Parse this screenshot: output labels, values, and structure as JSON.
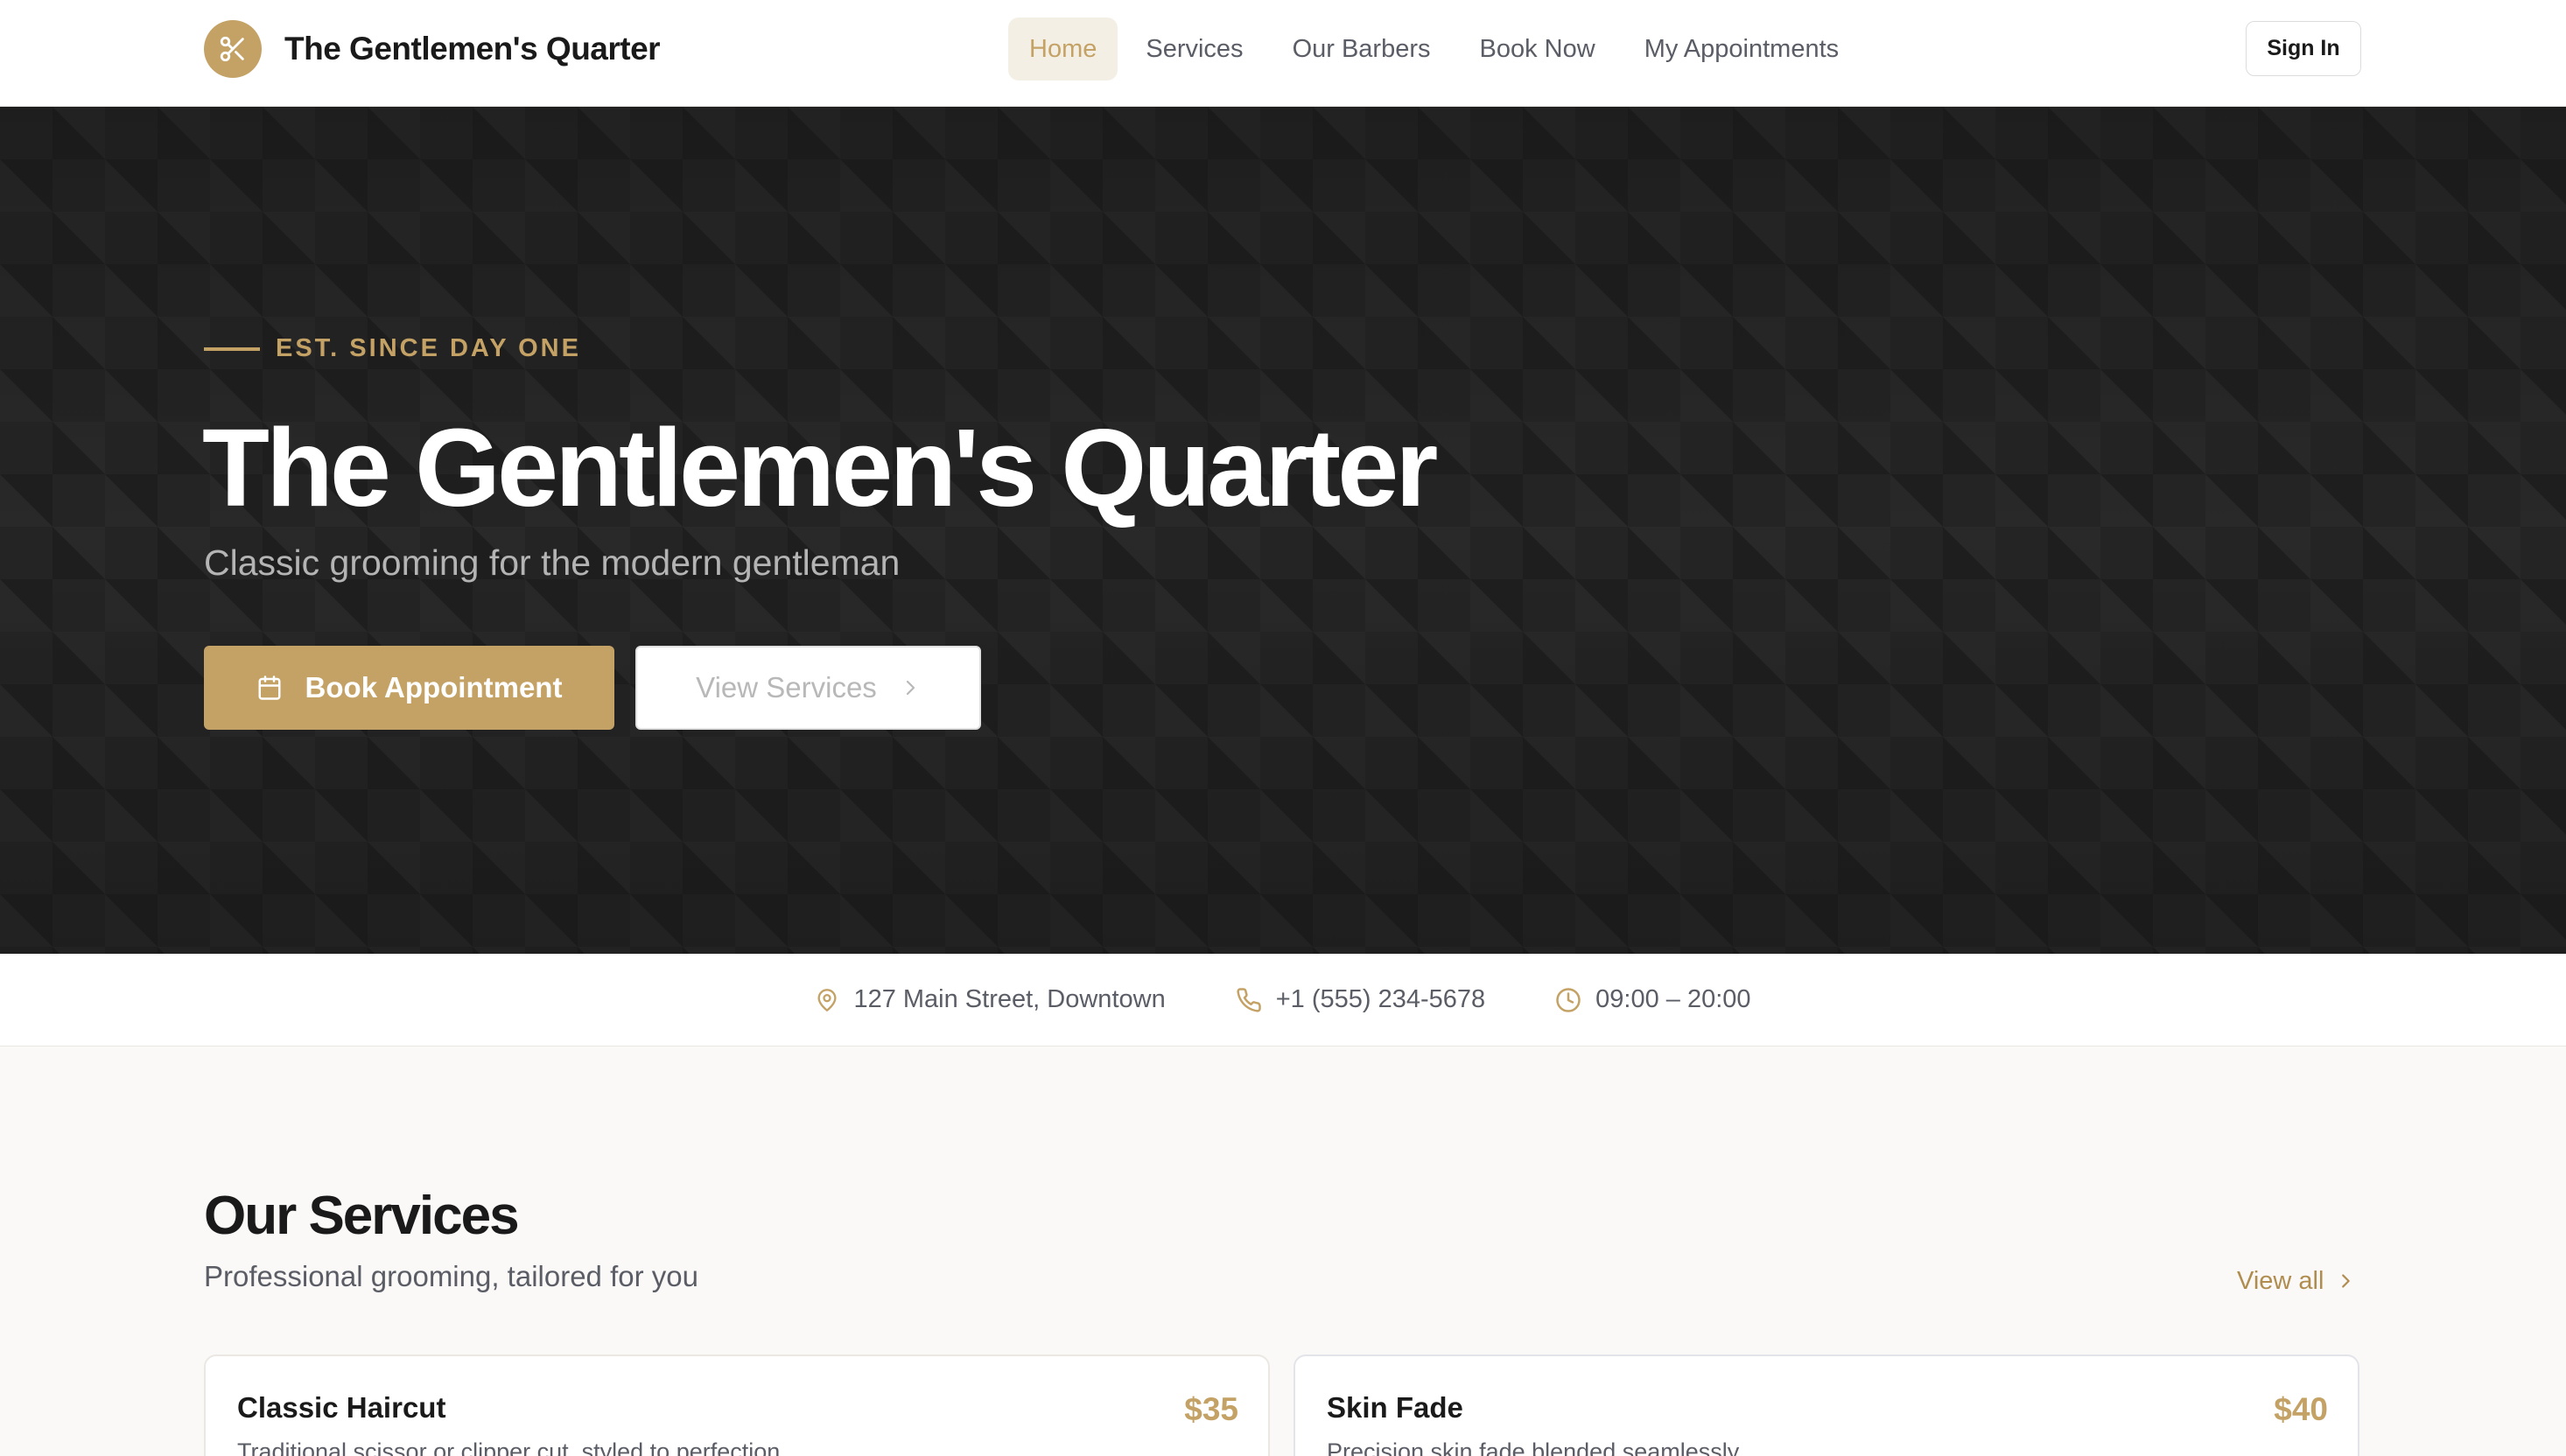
{
  "header": {
    "brand_name": "The Gentlemen's Quarter",
    "nav": [
      {
        "label": "Home",
        "active": true
      },
      {
        "label": "Services",
        "active": false
      },
      {
        "label": "Our Barbers",
        "active": false
      },
      {
        "label": "Book Now",
        "active": false
      },
      {
        "label": "My Appointments",
        "active": false
      }
    ],
    "signin_label": "Sign In"
  },
  "hero": {
    "eyebrow": "EST. SINCE DAY ONE",
    "title": "The Gentlemen's Quarter",
    "subtitle": "Classic grooming for the modern gentleman",
    "primary_button": "Book Appointment",
    "secondary_button": "View Services"
  },
  "info": {
    "address": "127 Main Street, Downtown",
    "phone": "+1 (555) 234-5678",
    "hours": "09:00 – 20:00"
  },
  "services": {
    "title": "Our Services",
    "subtitle": "Professional grooming, tailored for you",
    "view_all": "View all",
    "items": [
      {
        "name": "Classic Haircut",
        "price": "$35",
        "description": "Traditional scissor or clipper cut, styled to perfection"
      },
      {
        "name": "Skin Fade",
        "price": "$40",
        "description": "Precision skin fade blended seamlessly"
      }
    ]
  },
  "colors": {
    "accent": "#c4a265",
    "hero_bg": "#242424",
    "text_dark": "#1a1a1a",
    "text_muted": "#5b5d66"
  },
  "icons": {
    "logo": "scissors-icon",
    "book": "calendar-icon",
    "view": "chevron-right-icon",
    "address": "map-pin-icon",
    "phone": "phone-icon",
    "hours": "clock-icon"
  }
}
